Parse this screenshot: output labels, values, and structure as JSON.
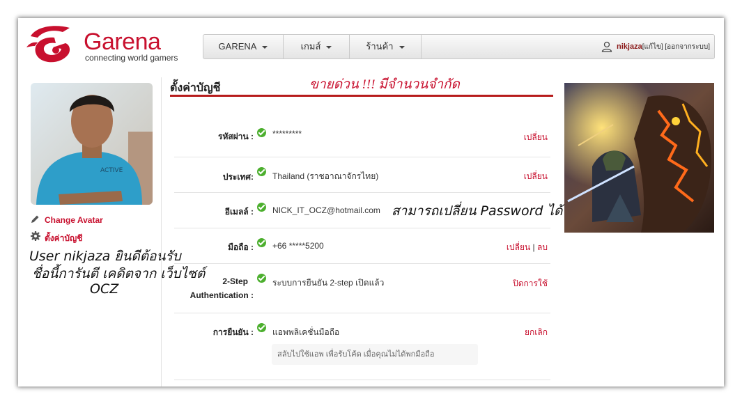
{
  "brand": {
    "name": "Garena",
    "tagline": "connecting world gamers",
    "color": "#c8102e"
  },
  "nav": {
    "items": [
      {
        "label": "GARENA"
      },
      {
        "label": "เกมส์"
      },
      {
        "label": "ร้านค้า"
      }
    ],
    "username": "nikjaza",
    "edit_label": "[แก้ไข]",
    "logout_label": "[ออกจากระบบ]"
  },
  "sidebar": {
    "change_avatar": "Change Avatar",
    "settings": "ตั้งค่าบัญชี",
    "overlay_lines": [
      "User nikjaza ยินดีต้อนรับ",
      "ชื่อนี้การันตี เคดิตจาก เว็บไซต์",
      "OCZ"
    ]
  },
  "main": {
    "title": "ตั้งค่าบัญชี",
    "promo": "ขายด่วน !!! มีจำนวนจำกัด",
    "overlay_note": "สามารถเปลี่ยน Password  ได้",
    "rows": [
      {
        "label": "รหัสผ่าน :",
        "value": "*********",
        "action": "เปลี่ยน"
      },
      {
        "label": "ประเทศ:",
        "value": "Thailand (ราชอาณาจักรไทย)",
        "action": "เปลี่ยน"
      },
      {
        "label": "อีเมลล์ :",
        "value": "NICK_IT_OCZ@hotmail.com",
        "action": ""
      },
      {
        "label": "มือถือ :",
        "value": "+66 *****5200",
        "action": "เปลี่ยน",
        "action2": "ลบ",
        "sep": "|"
      },
      {
        "label": "2-Step",
        "label2": "Authentication :",
        "value": "ระบบการยืนยัน 2-step เปิดแล้ว",
        "action": "ปิดการใช้"
      },
      {
        "label": "การยืนยัน :",
        "value": "แอพพลิเคชั่นมือถือ",
        "action": "ยกเลิก"
      }
    ],
    "hint": "สลับไปใช้แอพ เพื่อรับโค้ด เมื่อคุณไม่ได้พกมือถือ"
  },
  "colors": {
    "accent": "#c8102e",
    "check": "#4caf2e",
    "rule": "#b71c1c"
  }
}
